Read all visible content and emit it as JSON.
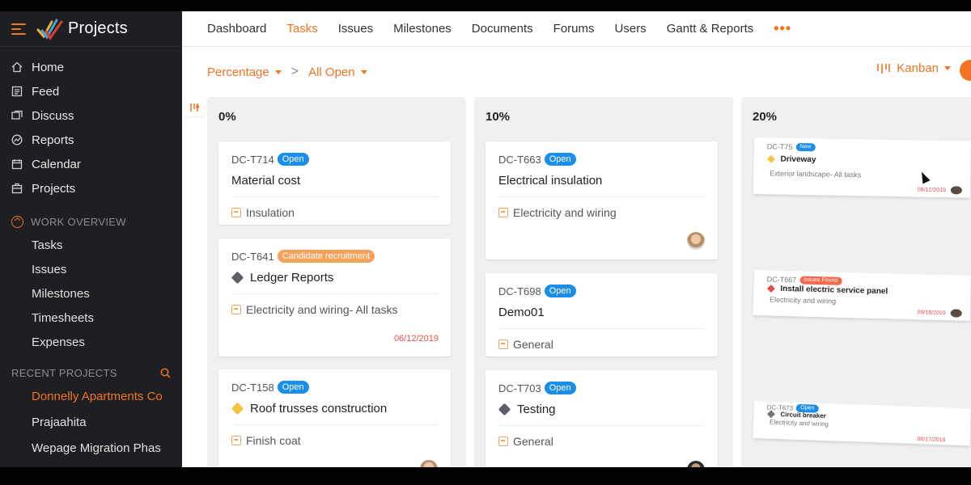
{
  "app": {
    "title": "Projects"
  },
  "sidebar": {
    "nav": [
      {
        "label": "Home",
        "icon": "home-icon"
      },
      {
        "label": "Feed",
        "icon": "feed-icon"
      },
      {
        "label": "Discuss",
        "icon": "discuss-icon"
      },
      {
        "label": "Reports",
        "icon": "reports-icon"
      },
      {
        "label": "Calendar",
        "icon": "calendar-icon"
      },
      {
        "label": "Projects",
        "icon": "projects-icon"
      }
    ],
    "work_overview": {
      "heading": "WORK OVERVIEW",
      "items": [
        "Tasks",
        "Issues",
        "Milestones",
        "Timesheets",
        "Expenses"
      ]
    },
    "recent": {
      "heading": "RECENT PROJECTS",
      "items": [
        "Donnelly Apartments Co",
        "Prajaahita",
        "Wepage Migration Phas"
      ]
    }
  },
  "topnav": {
    "tabs": [
      "Dashboard",
      "Tasks",
      "Issues",
      "Milestones",
      "Documents",
      "Forums",
      "Users",
      "Gantt & Reports"
    ],
    "active": "Tasks",
    "more": "•••"
  },
  "toolbar": {
    "group_by": "Percentage",
    "filter": "All Open",
    "separator": ">",
    "view": "Kanban"
  },
  "columns": [
    {
      "title": "0%",
      "cards": [
        {
          "id": "DC-T714",
          "badge": "Open",
          "title": "Material cost",
          "tasklist": "Insulation"
        },
        {
          "id": "DC-T641",
          "badge": "Candidate recruitment",
          "title": "Ledger Reports",
          "tasklist": "Electricity and wiring- All tasks",
          "due": "06/12/2019"
        },
        {
          "id": "DC-T158",
          "badge": "Open",
          "title": "Roof trusses construction",
          "tasklist": "Finish coat"
        }
      ]
    },
    {
      "title": "10%",
      "cards": [
        {
          "id": "DC-T663",
          "badge": "Open",
          "title": "Electrical insulation",
          "tasklist": "Electricity and wiring"
        },
        {
          "id": "DC-T698",
          "badge": "Open",
          "title": "Demo01",
          "tasklist": "General"
        },
        {
          "id": "DC-T703",
          "badge": "Open",
          "title": "Testing",
          "tasklist": "General"
        }
      ]
    },
    {
      "title": "20%",
      "cards": [
        {
          "id": "DC-T75",
          "badge": "New",
          "title": "Driveway",
          "tasklist": "Exterior landscape- All tasks",
          "due": "08/12/2019"
        },
        {
          "id": "DC-T667",
          "badge": "Issues Found",
          "title": "Install electric service panel",
          "tasklist": "Electricity and wiring",
          "due": "09/18/2019"
        },
        {
          "id": "DC-T673",
          "badge": "Open",
          "title": "Circuit breaker",
          "tasklist": "Electricity and wiring",
          "due": "08/17/2019"
        }
      ]
    }
  ],
  "colors": {
    "accent": "#f37321",
    "badge_blue": "#1a8ee8",
    "badge_orange": "#f5a25d",
    "due_red": "#e84b4b",
    "sidebar_bg": "#1d1f22"
  }
}
